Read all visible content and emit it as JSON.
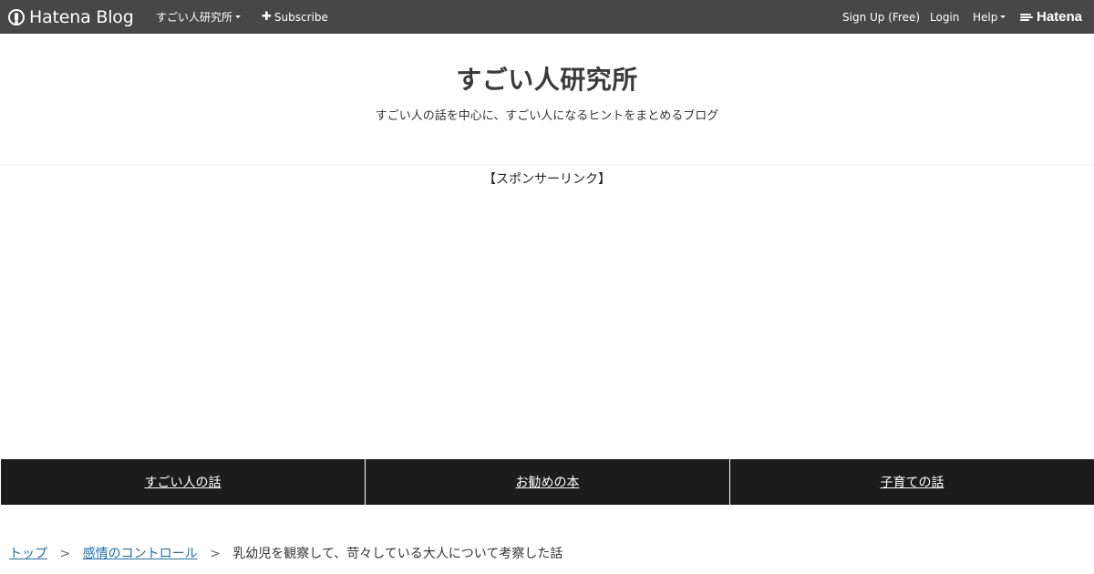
{
  "topbar": {
    "brand": "Hatena Blog",
    "blog_menu": "すごい人研究所",
    "subscribe": "Subscribe",
    "signup": "Sign Up (Free)",
    "login": "Login",
    "help": "Help",
    "hatena": "Hatena"
  },
  "header": {
    "title": "すごい人研究所",
    "description": "すごい人の話を中心に、すごい人になるヒントをまとめるブログ"
  },
  "sponsor_label": "【スポンサーリンク】",
  "nav": {
    "items": [
      {
        "label": "すごい人の話"
      },
      {
        "label": "お勧めの本"
      },
      {
        "label": "子育ての話"
      }
    ]
  },
  "breadcrumb": {
    "home": "トップ",
    "separator": ">",
    "category": "感情のコントロール",
    "current": "乳幼児を観察して、苛々している大人について考察した話"
  },
  "colors": {
    "topbar_bg": "#474747",
    "nav_bg": "#1c1c1c",
    "link": "#1e6ea8"
  },
  "icons": {
    "brand": "hatena-blog-logo-icon",
    "subscribe": "plus-icon",
    "hatena": "hatena-logo-icon"
  }
}
